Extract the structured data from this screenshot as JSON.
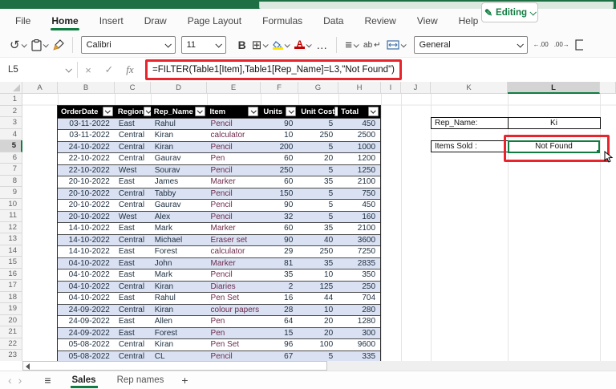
{
  "ribbon": {
    "tabs": [
      "File",
      "Home",
      "Insert",
      "Draw",
      "Page Layout",
      "Formulas",
      "Data",
      "Review",
      "View",
      "Help"
    ],
    "active_tab": "Home",
    "editing_label": "Editing"
  },
  "toolbar": {
    "font_name": "Calibri",
    "font_size": "11",
    "bold_label": "B",
    "font_color_label": "A",
    "wrap_label": "ab",
    "more_label": "…",
    "number_format": "General",
    "decrease_decimal_glyph": "←.00",
    "increase_decimal_glyph": ".00→"
  },
  "formula_bar": {
    "name_box": "L5",
    "cancel_glyph": "×",
    "enter_glyph": "✓",
    "fx_label": "fx",
    "formula": "=FILTER(Table1[Item],Table1[Rep_Name]=L3,\"Not Found\")"
  },
  "sheet": {
    "col_letters": [
      "A",
      "B",
      "C",
      "D",
      "E",
      "F",
      "G",
      "H",
      "I",
      "J",
      "K",
      "L"
    ],
    "active_col": "L",
    "row_count": 23,
    "active_row": 5,
    "selected_cell": "L5"
  },
  "table": {
    "headers": [
      "OrderDate",
      "Region",
      "Rep_Name",
      "Item",
      "Units",
      "Unit Cost",
      "Total"
    ],
    "rows": [
      [
        "03-11-2022",
        "East",
        "Rahul",
        "Pencil",
        "90",
        "5",
        "450"
      ],
      [
        "03-11-2022",
        "Central",
        "Kiran",
        "calculator",
        "10",
        "250",
        "2500"
      ],
      [
        "24-10-2022",
        "Central",
        "Kiran",
        "Pencil",
        "200",
        "5",
        "1000"
      ],
      [
        "22-10-2022",
        "Central",
        "Gaurav",
        "Pen",
        "60",
        "20",
        "1200"
      ],
      [
        "22-10-2022",
        "West",
        "Sourav",
        "Pencil",
        "250",
        "5",
        "1250"
      ],
      [
        "20-10-2022",
        "East",
        "James",
        "Marker",
        "60",
        "35",
        "2100"
      ],
      [
        "20-10-2022",
        "Central",
        "Tabby",
        "Pencil",
        "150",
        "5",
        "750"
      ],
      [
        "20-10-2022",
        "Central",
        "Gaurav",
        "Pencil",
        "90",
        "5",
        "450"
      ],
      [
        "20-10-2022",
        "West",
        "Alex",
        "Pencil",
        "32",
        "5",
        "160"
      ],
      [
        "14-10-2022",
        "East",
        "Mark",
        "Marker",
        "60",
        "35",
        "2100"
      ],
      [
        "14-10-2022",
        "Central",
        "Michael",
        "Eraser set",
        "90",
        "40",
        "3600"
      ],
      [
        "14-10-2022",
        "East",
        "Forest",
        "calculator",
        "29",
        "250",
        "7250"
      ],
      [
        "04-10-2022",
        "East",
        "John",
        "Marker",
        "81",
        "35",
        "2835"
      ],
      [
        "04-10-2022",
        "East",
        "Mark",
        "Pencil",
        "35",
        "10",
        "350"
      ],
      [
        "04-10-2022",
        "Central",
        "Kiran",
        "Diaries",
        "2",
        "125",
        "250"
      ],
      [
        "04-10-2022",
        "East",
        "Rahul",
        "Pen Set",
        "16",
        "44",
        "704"
      ],
      [
        "24-09-2022",
        "Central",
        "Kiran",
        "colour papers",
        "28",
        "10",
        "280"
      ],
      [
        "24-09-2022",
        "East",
        "Allen",
        "Pen",
        "64",
        "20",
        "1280"
      ],
      [
        "24-09-2022",
        "East",
        "Forest",
        "Pen",
        "15",
        "20",
        "300"
      ],
      [
        "05-08-2022",
        "Central",
        "Kiran",
        "Pen Set",
        "96",
        "100",
        "9600"
      ],
      [
        "05-08-2022",
        "Central",
        "CL",
        "Pencil",
        "67",
        "5",
        "335"
      ]
    ]
  },
  "lookup": {
    "rep_name_label": "Rep_Name:",
    "rep_name_value": "Ki",
    "items_sold_label": "Items Sold :",
    "items_sold_value": "Not Found"
  },
  "sheet_tabs": {
    "tabs": [
      "Sales",
      "Rep names"
    ],
    "active": "Sales",
    "add_label": "+"
  },
  "colors": {
    "excel_green": "#107C41",
    "titlebar_green": "#1c7044",
    "annotation_red": "#e8242c",
    "band_blue": "#D9E1F2",
    "table_header_bg": "#000000"
  }
}
